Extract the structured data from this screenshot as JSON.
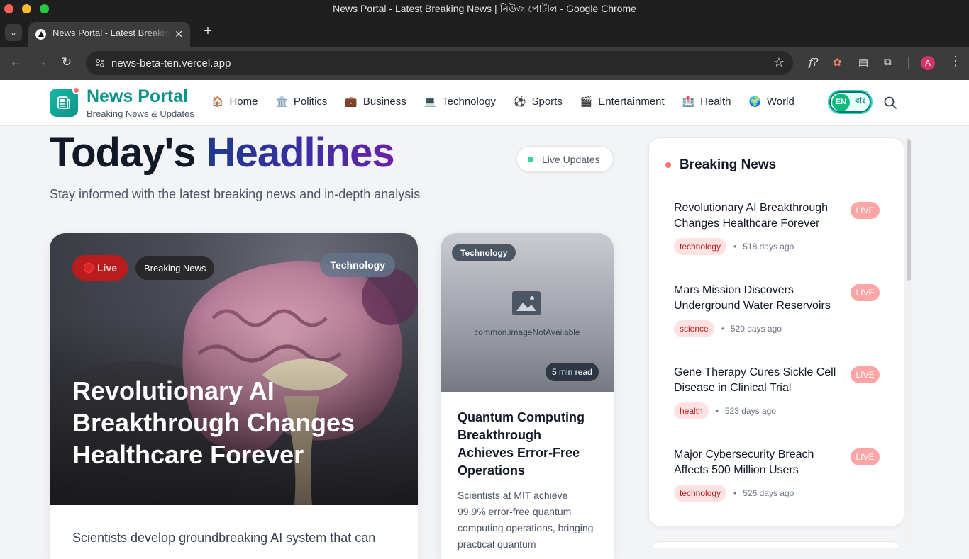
{
  "browser": {
    "window_title": "News Portal - Latest Breaking News | নিউজ পোর্টাল - Google Chrome",
    "tab_title": "News Portal - Latest Breaking News | নিউজ পোর্টাল",
    "url": "news-beta-ten.vercel.app",
    "profile_initial": "A",
    "colors": {
      "close": "#ff5f57",
      "minimize": "#febc2e",
      "maximize": "#28c840"
    }
  },
  "site": {
    "brand_title": "News Portal",
    "brand_subtitle": "Breaking News & Updates",
    "nav": [
      {
        "icon": "🏠",
        "label": "Home"
      },
      {
        "icon": "🏛️",
        "label": "Politics"
      },
      {
        "icon": "💼",
        "label": "Business"
      },
      {
        "icon": "💻",
        "label": "Technology"
      },
      {
        "icon": "⚽",
        "label": "Sports"
      },
      {
        "icon": "🎬",
        "label": "Entertainment"
      },
      {
        "icon": "🏥",
        "label": "Health"
      },
      {
        "icon": "🌍",
        "label": "World"
      }
    ],
    "lang": {
      "en": "EN",
      "bn": "বাং"
    }
  },
  "main": {
    "headline_part1": "Today's ",
    "headline_part2": "Headlines",
    "live_updates": "Live Updates",
    "subtitle": "Stay informed with the latest breaking news and in-depth analysis",
    "hero": {
      "live_tag": "Live",
      "breaking_tag": "Breaking News",
      "category": "Technology",
      "title": "Revolutionary AI Breakthrough Changes Healthcare Forever",
      "excerpt": "Scientists develop groundbreaking AI system that can"
    },
    "card2": {
      "category": "Technology",
      "image_fallback": "common.imageNotAvailable",
      "read_time": "5 min read",
      "title": "Quantum Computing Breakthrough Achieves Error-Free Operations",
      "excerpt": "Scientists at MIT achieve 99.9% error-free quantum computing operations, bringing practical quantum"
    }
  },
  "sidebar": {
    "title": "Breaking News",
    "live_label": "LIVE",
    "items": [
      {
        "title": "Revolutionary AI Breakthrough Changes Healthcare Forever",
        "category": "technology",
        "age": "518 days ago"
      },
      {
        "title": "Mars Mission Discovers Underground Water Reservoirs",
        "category": "science",
        "age": "520 days ago"
      },
      {
        "title": "Gene Therapy Cures Sickle Cell Disease in Clinical Trial",
        "category": "health",
        "age": "523 days ago"
      },
      {
        "title": "Major Cybersecurity Breach Affects 500 Million Users",
        "category": "technology",
        "age": "526 days ago"
      }
    ]
  }
}
